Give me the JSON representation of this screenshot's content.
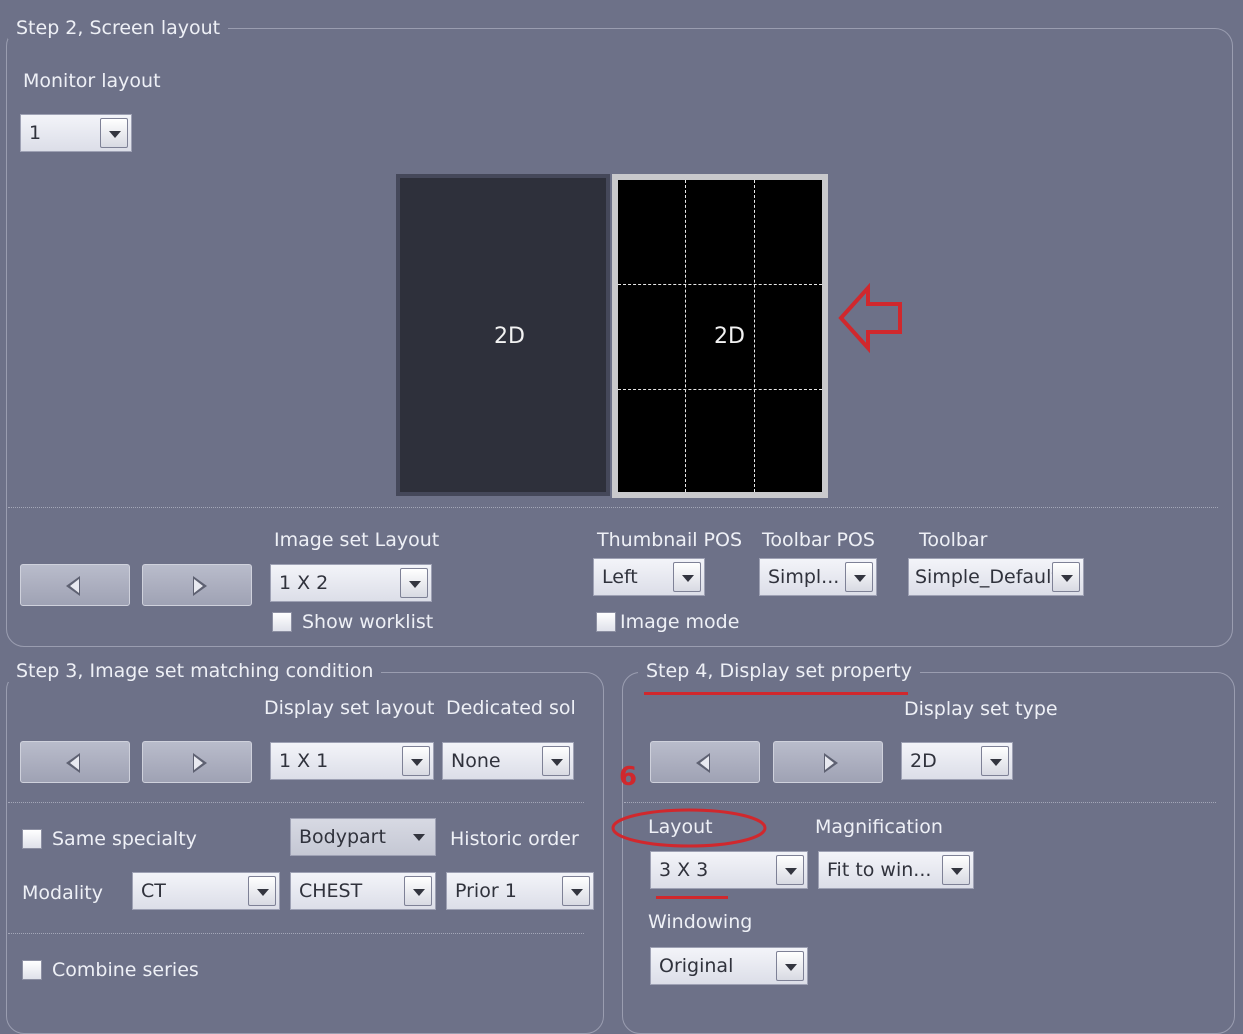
{
  "step2": {
    "title": "Step 2, Screen layout",
    "monitor_layout_label": "Monitor layout",
    "monitor_layout_value": "1",
    "preview_left_label": "2D",
    "preview_right_label": "2D",
    "image_set_layout_label": "Image set Layout",
    "image_set_layout_value": "1 X 2",
    "show_worklist_label": "Show worklist",
    "thumbnail_pos_label": "Thumbnail POS",
    "thumbnail_pos_value": "Left",
    "toolbar_pos_label": "Toolbar POS",
    "toolbar_pos_value": "Simpl...",
    "toolbar_label": "Toolbar",
    "toolbar_value": "Simple_Default",
    "image_mode_label": "Image mode"
  },
  "step3": {
    "title": "Step 3, Image set matching condition",
    "display_set_layout_label": "Display set layout",
    "display_set_layout_value": "1 X 1",
    "dedicated_label": "Dedicated solu",
    "dedicated_value": "None",
    "same_specialty_label": "Same specialty",
    "bodypart_value": "Bodypart",
    "historic_order_label": "Historic order",
    "modality_label": "Modality",
    "modality_value": "CT",
    "chest_value": "CHEST",
    "prior_value": "Prior 1",
    "combine_series_label": "Combine series"
  },
  "step4": {
    "title": "Step 4, Display set property",
    "display_set_type_label": "Display set type",
    "display_set_type_value": "2D",
    "annotation_number": "6",
    "layout_label": "Layout",
    "layout_value": "3 X 3",
    "magnification_label": "Magnification",
    "magnification_value": "Fit to win...",
    "windowing_label": "Windowing",
    "windowing_value": "Original"
  },
  "colors": {
    "background": "#6d7188",
    "annotation_red": "#d0282d"
  }
}
